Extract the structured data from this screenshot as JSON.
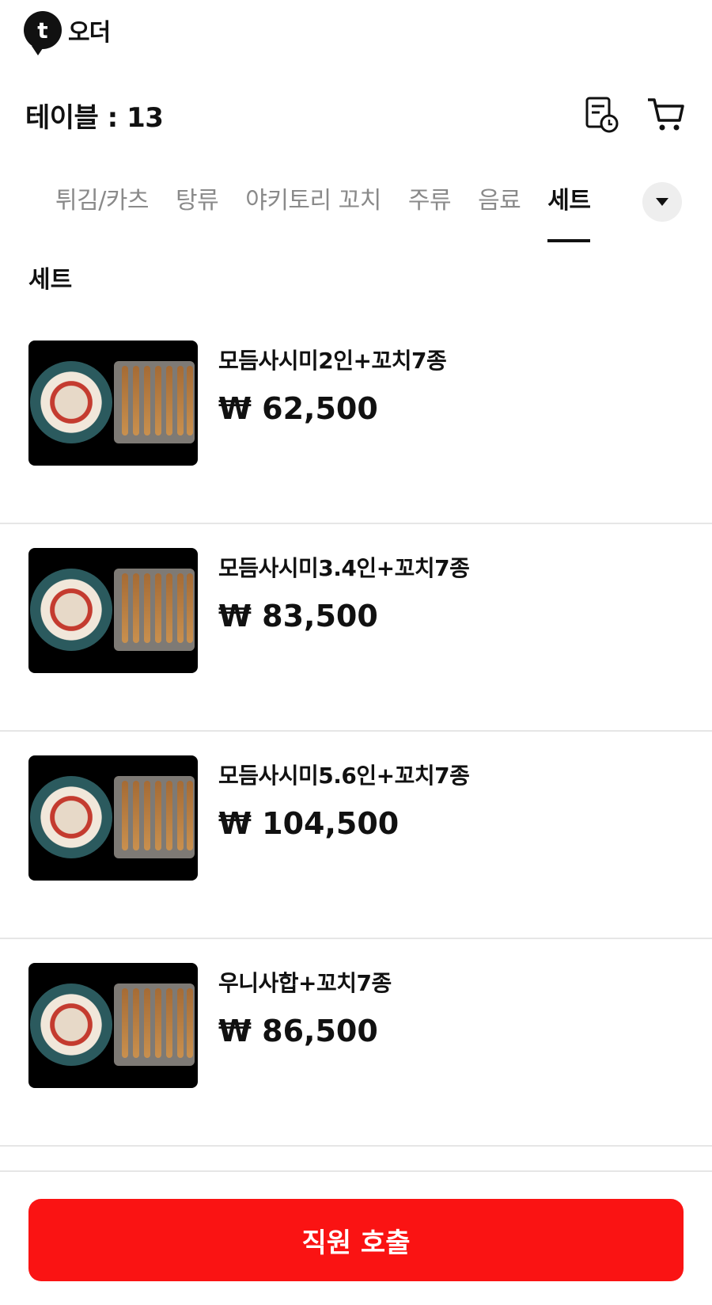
{
  "app": {
    "logo_mark": "t",
    "logo_text": "오더"
  },
  "header": {
    "table_label": "테이블 : 13",
    "icons": [
      "order-history-icon",
      "cart-icon"
    ]
  },
  "tabs": [
    {
      "label": "튀김/카츠",
      "active": false
    },
    {
      "label": "탕류",
      "active": false
    },
    {
      "label": "야키토리 꼬치",
      "active": false
    },
    {
      "label": "주류",
      "active": false
    },
    {
      "label": "음료",
      "active": false
    },
    {
      "label": "세트",
      "active": true
    }
  ],
  "section": {
    "title": "세트"
  },
  "menu_items": [
    {
      "name": "모듬사시미2인+꼬치7종",
      "price": "₩ 62,500"
    },
    {
      "name": "모듬사시미3.4인+꼬치7종",
      "price": "₩ 83,500"
    },
    {
      "name": "모듬사시미5.6인+꼬치7종",
      "price": "₩ 104,500"
    },
    {
      "name": "우니사합+꼬치7종",
      "price": "₩ 86,500"
    }
  ],
  "footer": {
    "call_label": "직원 호출"
  },
  "colors": {
    "accent": "#fa1313",
    "tab_inactive": "#8a8a8a",
    "text": "#111111"
  }
}
